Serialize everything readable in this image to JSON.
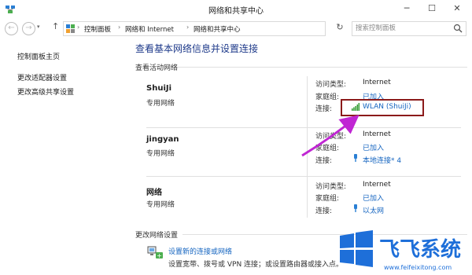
{
  "window": {
    "title": "网络和共享中心"
  },
  "address_bar": {
    "breadcrumb": [
      "控制面板",
      "网络和 Internet",
      "网络和共享中心"
    ]
  },
  "search": {
    "placeholder": "搜索控制面板"
  },
  "sidebar": {
    "items": [
      {
        "label": "控制面板主页"
      },
      {
        "label": "更改适配器设置"
      },
      {
        "label": "更改高级共享设置"
      }
    ]
  },
  "main": {
    "title": "查看基本网络信息并设置连接",
    "active_networks_header": "查看活动网络",
    "networks": [
      {
        "name": "ShuiJi",
        "type": "专用网络",
        "access_label": "访问类型:",
        "access_value": "Internet",
        "homegroup_label": "家庭组:",
        "homegroup_value": "已加入",
        "connection_label": "连接:",
        "connection_value": "WLAN (ShuiJi)",
        "connection_icon": "wifi-signal-icon"
      },
      {
        "name": "jingyan",
        "type": "专用网络",
        "access_label": "访问类型:",
        "access_value": "Internet",
        "homegroup_label": "家庭组:",
        "homegroup_value": "已加入",
        "connection_label": "连接:",
        "connection_value": "本地连接* 4",
        "connection_icon": "ethernet-plug-icon"
      },
      {
        "name": "网络",
        "type": "专用网络",
        "access_label": "访问类型:",
        "access_value": "Internet",
        "homegroup_label": "家庭组:",
        "homegroup_value": "已加入",
        "connection_label": "连接:",
        "connection_value": "以太网",
        "connection_icon": "ethernet-plug-icon"
      }
    ],
    "change_settings_header": "更改网络设置",
    "setup_link": "设置新的连接或网络",
    "setup_desc": "设置宽带、拨号或 VPN 连接；或设置路由器或接入点。"
  },
  "watermark": {
    "brand": "飞飞系统",
    "url": "www.feifeixitong.com"
  },
  "colors": {
    "link": "#1565c0",
    "highlight_border": "#8b1a1a",
    "arrow": "#c026d3",
    "title_blue": "#1e3a8a",
    "logo_blue": "#1e6fd9"
  }
}
